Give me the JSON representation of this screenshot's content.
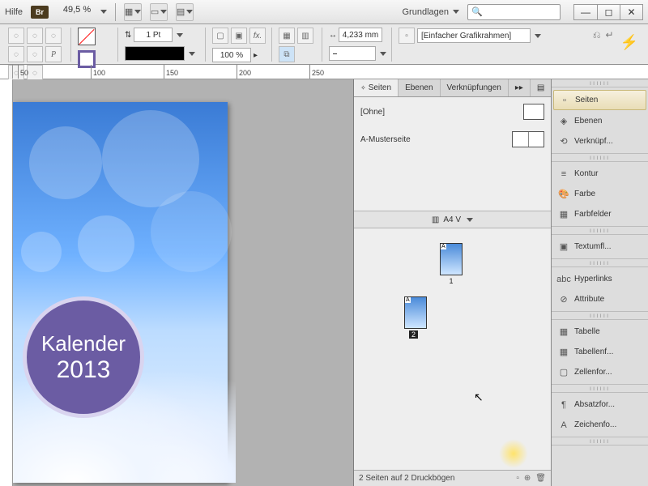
{
  "menu": {
    "help": "Hilfe",
    "br": "Br",
    "zoom": "49,5 %",
    "workspace": "Grundlagen",
    "search_placeholder": ""
  },
  "control": {
    "stroke_weight": "1 Pt",
    "opacity": "100 %",
    "ref_dim": "4,233 mm",
    "frame_fit": "[Einfacher Grafikrahmen]"
  },
  "ruler": {
    "t50": "50",
    "t100": "100",
    "t150": "150",
    "t200": "200",
    "t250": "250"
  },
  "document": {
    "badge_line1": "Kalender",
    "badge_line2": "2013"
  },
  "pages_panel": {
    "tabs": {
      "pages": "Seiten",
      "layers": "Ebenen",
      "links": "Verknüpfungen"
    },
    "masters": {
      "none": "[Ohne]",
      "a": "A-Musterseite"
    },
    "page_size": "A4 V",
    "page1_label": "1",
    "page2_label": "2",
    "status": "2 Seiten auf 2 Druckbögen"
  },
  "dock": {
    "g1": {
      "pages": "Seiten",
      "layers": "Ebenen",
      "links": "Verknüpf..."
    },
    "g2": {
      "stroke": "Kontur",
      "color": "Farbe",
      "swatches": "Farbfelder"
    },
    "g3": {
      "wrap": "Textumfl..."
    },
    "g4": {
      "hyper": "Hyperlinks",
      "attr": "Attribute"
    },
    "g5": {
      "table": "Tabelle",
      "tablef": "Tabellenf...",
      "cellf": "Zellenfor..."
    },
    "g6": {
      "paraf": "Absatzfor...",
      "charf": "Zeichenfo..."
    }
  }
}
